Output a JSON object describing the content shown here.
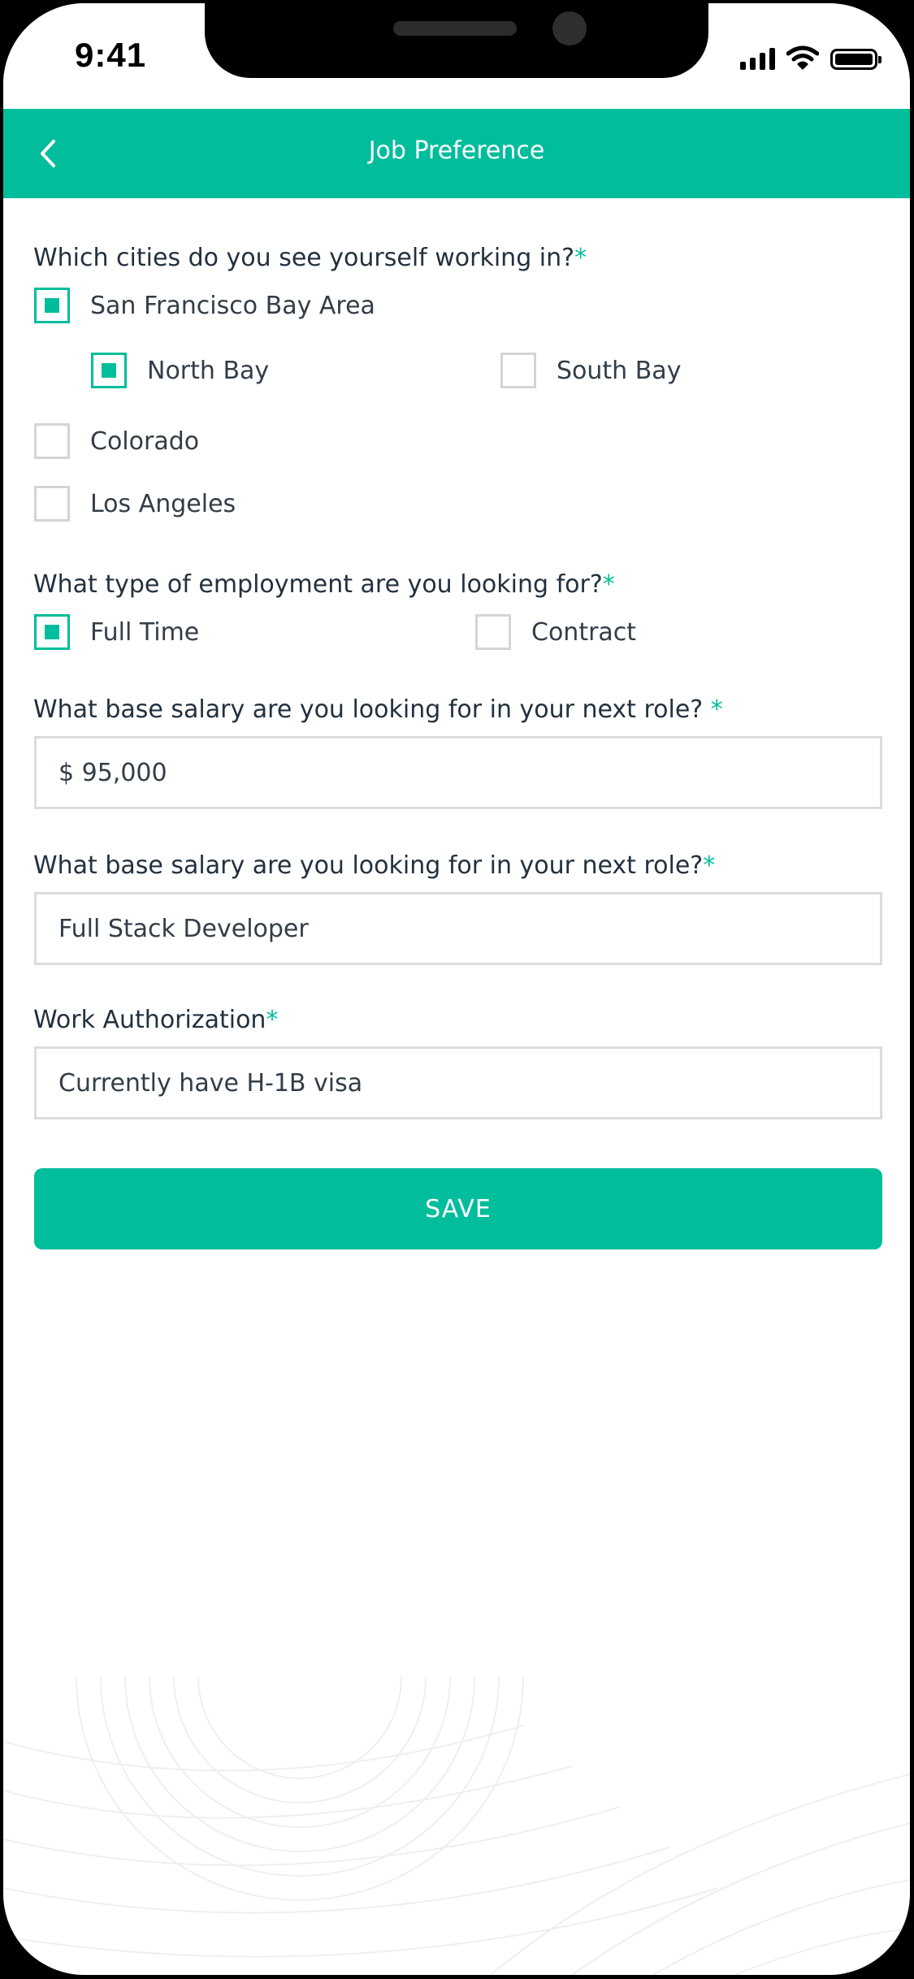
{
  "status_bar": {
    "time": "9:41"
  },
  "header": {
    "title": "Job Preference",
    "back_icon": "chevron-left-icon"
  },
  "cities": {
    "question": "Which cities do you see yourself working in?",
    "required_mark": "*",
    "options": [
      {
        "label": "San Francisco Bay Area",
        "checked": true
      },
      {
        "label": "North Bay",
        "checked": true
      },
      {
        "label": "South Bay",
        "checked": false
      },
      {
        "label": "Colorado",
        "checked": false
      },
      {
        "label": "Los Angeles",
        "checked": false
      }
    ]
  },
  "employment": {
    "question": "What type of employment are you looking for?",
    "required_mark": "*",
    "options": [
      {
        "label": "Full Time",
        "checked": true
      },
      {
        "label": "Contract",
        "checked": false
      }
    ]
  },
  "salary": {
    "question": "What base salary are you looking for in your next role? ",
    "required_mark": "*",
    "value": "$ 95,000"
  },
  "role": {
    "question": "What base salary are you looking for in your next role?",
    "required_mark": "*",
    "value": "Full Stack Developer"
  },
  "work_authorization": {
    "question": "Work Authorization",
    "required_mark": "*",
    "value": "Currently have H-1B visa"
  },
  "save_button": {
    "label": "SAVE"
  },
  "colors": {
    "accent": "#00bd9b",
    "text": "#22313f",
    "border": "#dcdcdc"
  }
}
